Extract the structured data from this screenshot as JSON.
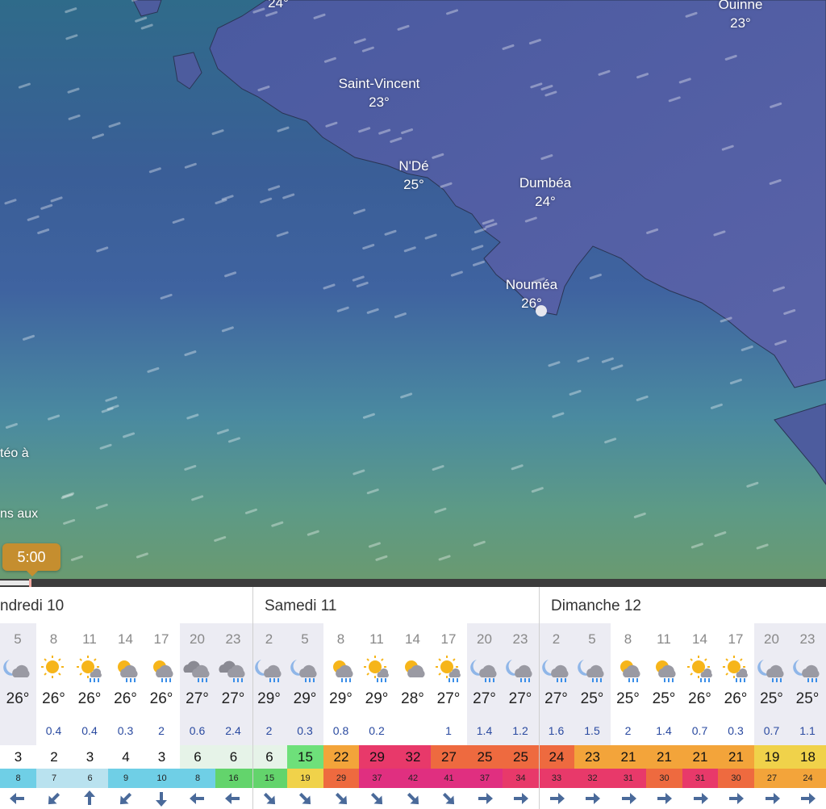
{
  "map": {
    "cities": [
      {
        "name": "",
        "temp": "24°"
      },
      {
        "name": "Ouinne",
        "temp": "23°"
      },
      {
        "name": "Saint-Vincent",
        "temp": "23°"
      },
      {
        "name": "N'Dé",
        "temp": "25°"
      },
      {
        "name": "Dumbéa",
        "temp": "24°"
      },
      {
        "name": "Nouméa",
        "temp": "26°"
      }
    ],
    "side_texts": [
      "téo à",
      "ns aux"
    ],
    "time_label": "5:00"
  },
  "colors": {
    "time_bubble": "#c58e2f",
    "rain_text": "#2a4aa0",
    "night_band": "#ececf3"
  },
  "forecast": {
    "days": [
      {
        "label": "ndredi 10"
      },
      {
        "label": "Samedi 11"
      },
      {
        "label": "Dimanche 12"
      }
    ],
    "hours": [
      {
        "h": "5",
        "icon": "moon-cloud-icon",
        "temp": "26°",
        "rain": "",
        "gust": "3",
        "wind": "8",
        "dir": "arrow-left-icon",
        "night": true
      },
      {
        "h": "8",
        "icon": "sun-icon",
        "temp": "26°",
        "rain": "0.4",
        "gust": "2",
        "wind": "7",
        "dir": "arrow-down-left-icon",
        "night": false
      },
      {
        "h": "11",
        "icon": "sun-rain-icon",
        "temp": "26°",
        "rain": "0.4",
        "gust": "3",
        "wind": "6",
        "dir": "arrow-up-icon",
        "night": false
      },
      {
        "h": "14",
        "icon": "sun-cloud-rain-icon",
        "temp": "26°",
        "rain": "0.3",
        "gust": "4",
        "wind": "9",
        "dir": "arrow-down-left-icon",
        "night": false
      },
      {
        "h": "17",
        "icon": "sun-cloud-rain-icon",
        "temp": "26°",
        "rain": "2",
        "gust": "3",
        "wind": "10",
        "dir": "arrow-down-icon",
        "night": false
      },
      {
        "h": "20",
        "icon": "cloud-rain-icon",
        "temp": "27°",
        "rain": "0.6",
        "gust": "6",
        "wind": "8",
        "dir": "arrow-left-icon",
        "night": true
      },
      {
        "h": "23",
        "icon": "cloud-rain-icon",
        "temp": "27°",
        "rain": "2.4",
        "gust": "6",
        "wind": "16",
        "dir": "arrow-left-icon",
        "night": true
      },
      {
        "h": "2",
        "icon": "moon-rain-icon",
        "temp": "29°",
        "rain": "2",
        "gust": "6",
        "wind": "15",
        "dir": "arrow-down-right-icon",
        "night": true
      },
      {
        "h": "5",
        "icon": "moon-rain-icon",
        "temp": "29°",
        "rain": "0.3",
        "gust": "15",
        "wind": "19",
        "dir": "arrow-down-right-icon",
        "night": true
      },
      {
        "h": "8",
        "icon": "sun-cloud-rain-icon",
        "temp": "29°",
        "rain": "0.8",
        "gust": "22",
        "wind": "29",
        "dir": "arrow-down-right-icon",
        "night": false
      },
      {
        "h": "11",
        "icon": "sun-rain-icon",
        "temp": "29°",
        "rain": "0.2",
        "gust": "29",
        "wind": "37",
        "dir": "arrow-down-right-icon",
        "night": false
      },
      {
        "h": "14",
        "icon": "sun-cloud-icon",
        "temp": "28°",
        "rain": "",
        "gust": "32",
        "wind": "42",
        "dir": "arrow-down-right-icon",
        "night": false
      },
      {
        "h": "17",
        "icon": "sun-rain-icon",
        "temp": "27°",
        "rain": "1",
        "gust": "27",
        "wind": "41",
        "dir": "arrow-down-right-icon",
        "night": false
      },
      {
        "h": "20",
        "icon": "moon-rain-icon",
        "temp": "27°",
        "rain": "1.4",
        "gust": "25",
        "wind": "37",
        "dir": "arrow-right-icon",
        "night": true
      },
      {
        "h": "23",
        "icon": "moon-rain-icon",
        "temp": "27°",
        "rain": "1.2",
        "gust": "25",
        "wind": "34",
        "dir": "arrow-right-icon",
        "night": true
      },
      {
        "h": "2",
        "icon": "moon-rain-icon",
        "temp": "27°",
        "rain": "1.6",
        "gust": "24",
        "wind": "33",
        "dir": "arrow-right-icon",
        "night": true
      },
      {
        "h": "5",
        "icon": "moon-rain-icon",
        "temp": "25°",
        "rain": "1.5",
        "gust": "23",
        "wind": "32",
        "dir": "arrow-right-icon",
        "night": true
      },
      {
        "h": "8",
        "icon": "sun-cloud-rain-icon",
        "temp": "25°",
        "rain": "2",
        "gust": "21",
        "wind": "31",
        "dir": "arrow-right-icon",
        "night": false
      },
      {
        "h": "11",
        "icon": "sun-cloud-rain-icon",
        "temp": "25°",
        "rain": "1.4",
        "gust": "21",
        "wind": "30",
        "dir": "arrow-right-icon",
        "night": false
      },
      {
        "h": "14",
        "icon": "sun-rain-icon",
        "temp": "26°",
        "rain": "0.7",
        "gust": "21",
        "wind": "31",
        "dir": "arrow-right-icon",
        "night": false
      },
      {
        "h": "17",
        "icon": "sun-rain-icon",
        "temp": "26°",
        "rain": "0.3",
        "gust": "21",
        "wind": "30",
        "dir": "arrow-right-icon",
        "night": false
      },
      {
        "h": "20",
        "icon": "moon-rain-icon",
        "temp": "25°",
        "rain": "0.7",
        "gust": "19",
        "wind": "27",
        "dir": "arrow-right-icon",
        "night": true
      },
      {
        "h": "23",
        "icon": "moon-rain-icon",
        "temp": "25°",
        "rain": "1.1",
        "gust": "18",
        "wind": "24",
        "dir": "arrow-right-icon",
        "night": true
      }
    ]
  }
}
